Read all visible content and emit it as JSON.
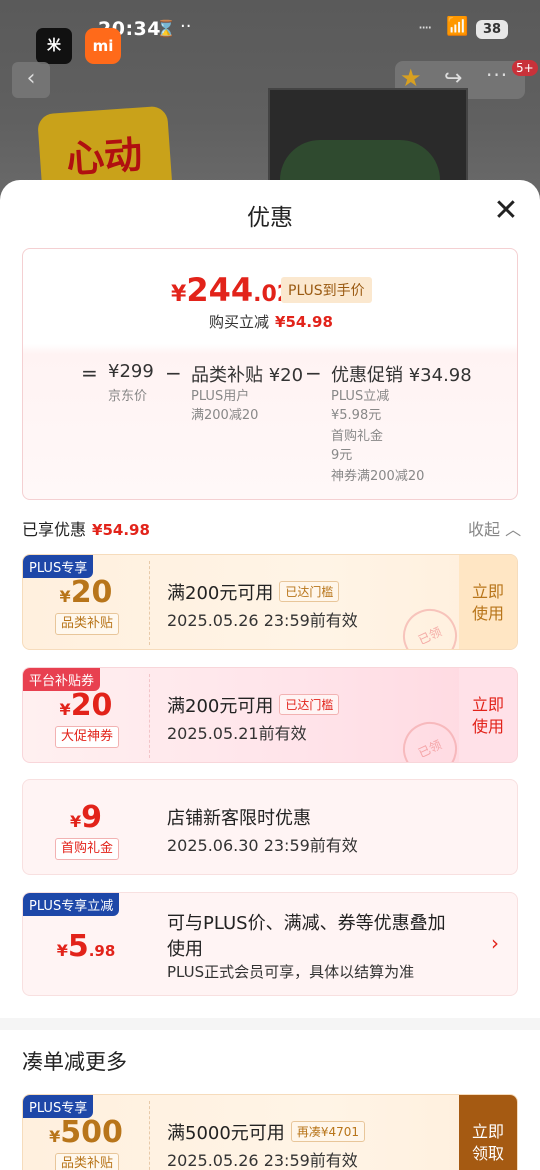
{
  "status_bar": {
    "time": "20:34",
    "battery": "38"
  },
  "background_page": {
    "promo_text": "心动",
    "badge_count": "5+"
  },
  "sheet": {
    "title": "优惠",
    "price": {
      "symbol": "¥",
      "integer": "244",
      "decimal": ".02",
      "tag": "PLUS到手价",
      "buy_label": "购买立减",
      "buy_value": "¥54.98"
    },
    "breakdown": {
      "eq": "=",
      "jd_price": "¥299",
      "jd_label": "京东价",
      "minus1": "−",
      "subsidy": "品类补贴 ¥20",
      "subsidy_line1": "PLUS用户",
      "subsidy_line2": "满200减20",
      "minus2": "−",
      "promo": "优惠促销 ¥34.98",
      "promo_line1": "PLUS立减",
      "promo_line2": "¥5.98元",
      "promo_line3": "首购礼金",
      "promo_line4": "9元",
      "promo_line5": "神券满200减20"
    },
    "enjoyed": {
      "label": "已享优惠",
      "value": "¥54.98",
      "collapse": "收起 ︿"
    },
    "coupons": [
      {
        "tag": "PLUS专享",
        "symbol": "¥",
        "amount": "20",
        "kind": "品类补贴",
        "title": "满200元可用",
        "pill": "已达门槛",
        "validity": "2025.05.26 23:59前有效",
        "action": "立即\n使用",
        "stamp": "已领"
      },
      {
        "tag": "平台补贴券",
        "symbol": "¥",
        "amount": "20",
        "kind": "大促神券",
        "title": "满200元可用",
        "pill": "已达门槛",
        "validity": "2025.05.21前有效",
        "action": "立即\n使用",
        "stamp": "已领"
      },
      {
        "symbol": "¥",
        "amount": "9",
        "kind": "首购礼金",
        "title": "店铺新客限时优惠",
        "validity": "2025.06.30 23:59前有效"
      },
      {
        "tag": "PLUS专享立减",
        "symbol": "¥",
        "amount": "5",
        "decimal": ".98",
        "title1": "可与PLUS价、满减、券等优惠叠加",
        "title2": "使用",
        "note": "PLUS正式会员可享，具体以结算为准",
        "chevron": "›"
      }
    ],
    "more_section": {
      "title": "凑单减更多",
      "coupon": {
        "tag": "PLUS专享",
        "symbol": "¥",
        "amount": "500",
        "kind": "品类补贴",
        "title": "满5000元可用",
        "pill": "再凑¥4701",
        "validity": "2025.05.26 23:59前有效",
        "action": "立即\n领取"
      }
    }
  },
  "colors": {
    "accent_red": "#e2231a",
    "plus_blue": "#1e47a8",
    "gold": "#b8751a"
  }
}
